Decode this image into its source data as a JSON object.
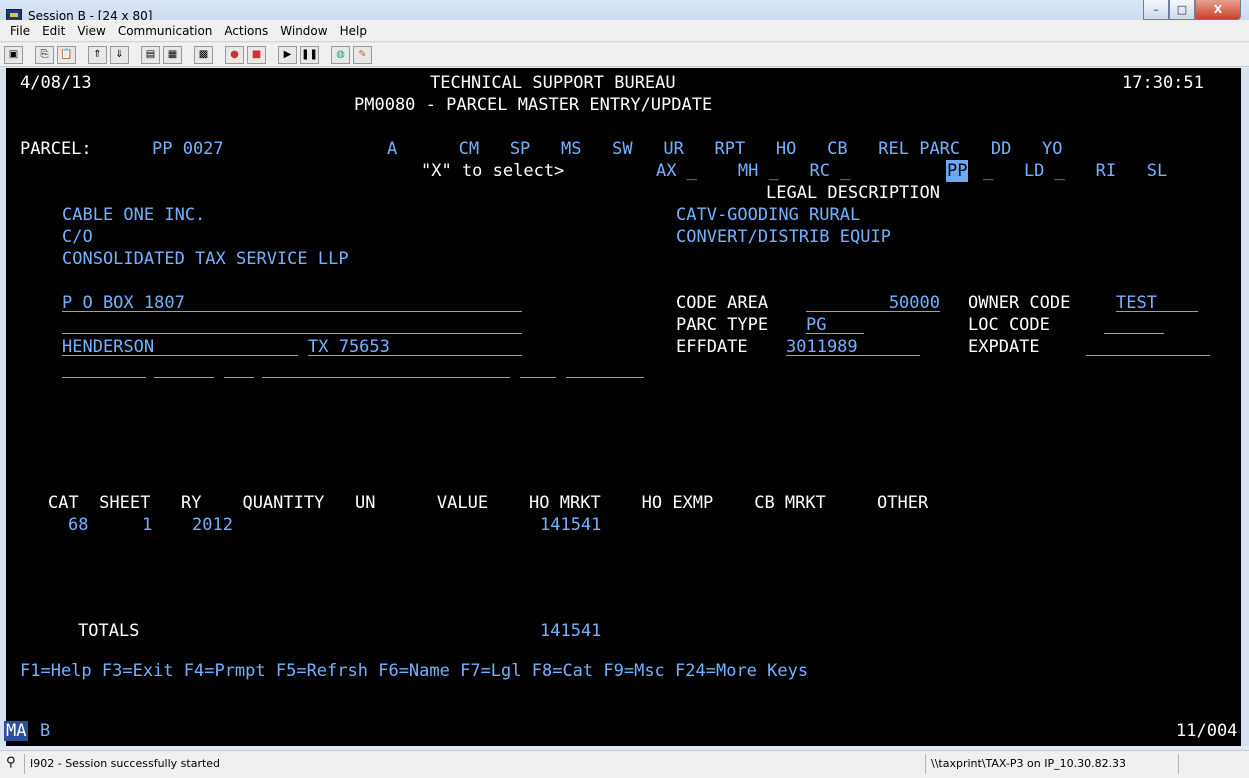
{
  "window": {
    "title": "Session B - [24 x 80]",
    "min": "–",
    "max": "□",
    "close": "X"
  },
  "menu": [
    "File",
    "Edit",
    "View",
    "Communication",
    "Actions",
    "Window",
    "Help"
  ],
  "toolbar_icons": [
    "print-screen-icon",
    "copy-icon",
    "paste-icon",
    "send-icon",
    "receive-icon",
    "display-icon",
    "keypad-icon",
    "macro-icon",
    "record-icon",
    "stop-icon",
    "play-icon",
    "pause-icon",
    "globe-icon",
    "edit-icon"
  ],
  "screen": {
    "date": "4/08/13",
    "org": "TECHNICAL SUPPORT BUREAU",
    "time": "17:30:51",
    "subtitle": "PM0080 - PARCEL MASTER ENTRY/UPDATE",
    "parcel_label": "PARCEL:",
    "parcel_value": "PP 0027",
    "flags_row": "A      CM   SP   MS   SW   UR   RPT   HO   CB   REL PARC   DD   YO",
    "select_label": "\"X\" to select>",
    "select_row": "AX _    MH _   RC _",
    "select_pp": "PP",
    "select_row2": "_   LD _   RI   SL",
    "legal_header": "LEGAL DESCRIPTION",
    "owner_line1": "CABLE ONE INC.",
    "owner_line2": "C/O",
    "owner_line3": "CONSOLIDATED TAX SERVICE LLP",
    "legal_line1": "CATV-GOODING RURAL",
    "legal_line2": "CONVERT/DISTRIB EQUIP",
    "address1": "P O BOX 1807",
    "city": "HENDERSON",
    "state_zip": "TX 75653",
    "code_area_label": "CODE AREA",
    "code_area_value": "50000",
    "owner_code_label": "OWNER CODE",
    "owner_code_value": "TEST",
    "parc_type_label": "PARC TYPE",
    "parc_type_value": "PG",
    "loc_code_label": "LOC CODE",
    "effdate_label": "EFFDATE",
    "effdate_value": "3011989",
    "expdate_label": "EXPDATE",
    "table_header": "CAT  SHEET   RY    QUANTITY   UN      VALUE    HO MRKT    HO EXMP    CB MRKT     OTHER",
    "row1": {
      "cat": "68",
      "sheet": "1",
      "ry": "2012",
      "value": "141541"
    },
    "totals_label": "TOTALS",
    "totals_value": "141541",
    "function_keys": "F1=Help F3=Exit F4=Prmpt F5=Refrsh F6=Name F7=Lgl F8=Cat F9=Msc F24=More Keys"
  },
  "oia": {
    "left": "MA",
    "session": "B",
    "cursor_pos": "11/004"
  },
  "status": {
    "message": "I902 - Session successfully started",
    "printer": "\\\\taxprint\\TAX-P3 on IP_10.30.82.33"
  }
}
